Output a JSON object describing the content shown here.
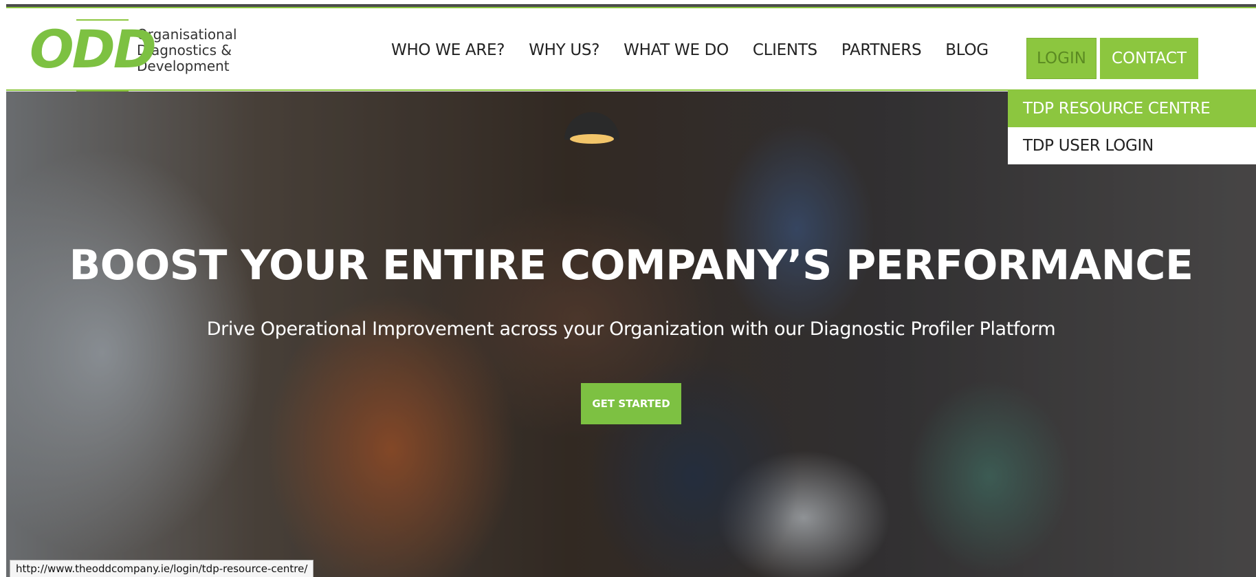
{
  "brand": {
    "logo_mark": "ODD",
    "logo_line1": "Organisational",
    "logo_line2": "Diagnostics &",
    "logo_line3": "Development",
    "accent_color": "#8cc63f"
  },
  "nav": {
    "items": [
      "WHO WE ARE?",
      "WHY US?",
      "WHAT WE DO",
      "CLIENTS",
      "PARTNERS",
      "BLOG"
    ],
    "login_label": "LOGIN",
    "contact_label": "CONTACT"
  },
  "login_dropdown": {
    "items": [
      "TDP RESOURCE CENTRE",
      "TDP USER LOGIN"
    ],
    "active_index": 0
  },
  "hero": {
    "title": "BOOST YOUR ENTIRE COMPANY’S PERFORMANCE",
    "subtitle": "Drive Operational Improvement across your Organization with our Diagnostic Profiler Platform",
    "cta_label": "GET STARTED"
  },
  "status_bar": {
    "url": "http://www.theoddcompany.ie/login/tdp-resource-centre/"
  }
}
